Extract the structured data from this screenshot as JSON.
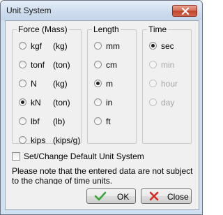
{
  "window": {
    "title": "Unit System"
  },
  "force_group": {
    "title": "Force (Mass)",
    "options": [
      {
        "label": "kgf",
        "unit": "(kg)",
        "selected": false
      },
      {
        "label": "tonf",
        "unit": "(ton)",
        "selected": false
      },
      {
        "label": "N",
        "unit": "(kg)",
        "selected": false
      },
      {
        "label": "kN",
        "unit": "(ton)",
        "selected": true
      },
      {
        "label": "lbf",
        "unit": "(lb)",
        "selected": false
      },
      {
        "label": "kips",
        "unit": "(kips/g)",
        "selected": false
      }
    ]
  },
  "length_group": {
    "title": "Length",
    "options": [
      {
        "label": "mm",
        "selected": false
      },
      {
        "label": "cm",
        "selected": false
      },
      {
        "label": "m",
        "selected": true
      },
      {
        "label": "in",
        "selected": false
      },
      {
        "label": "ft",
        "selected": false
      }
    ]
  },
  "time_group": {
    "title": "Time",
    "options": [
      {
        "label": "sec",
        "selected": true,
        "enabled": true
      },
      {
        "label": "min",
        "selected": false,
        "enabled": false
      },
      {
        "label": "hour",
        "selected": false,
        "enabled": false
      },
      {
        "label": "day",
        "selected": false,
        "enabled": false
      }
    ]
  },
  "default_checkbox": {
    "label": "Set/Change Default Unit System",
    "checked": false
  },
  "note": "Please note that the entered data are not subject to the change of time units.",
  "buttons": {
    "ok": "OK",
    "close": "Close"
  },
  "colors": {
    "ok_check": "#3aa63a",
    "close_x": "#d42a1e",
    "title_close": "#c2452b"
  },
  "icons": {
    "ok": "check-icon",
    "close": "close-icon",
    "title_close": "close-icon"
  }
}
